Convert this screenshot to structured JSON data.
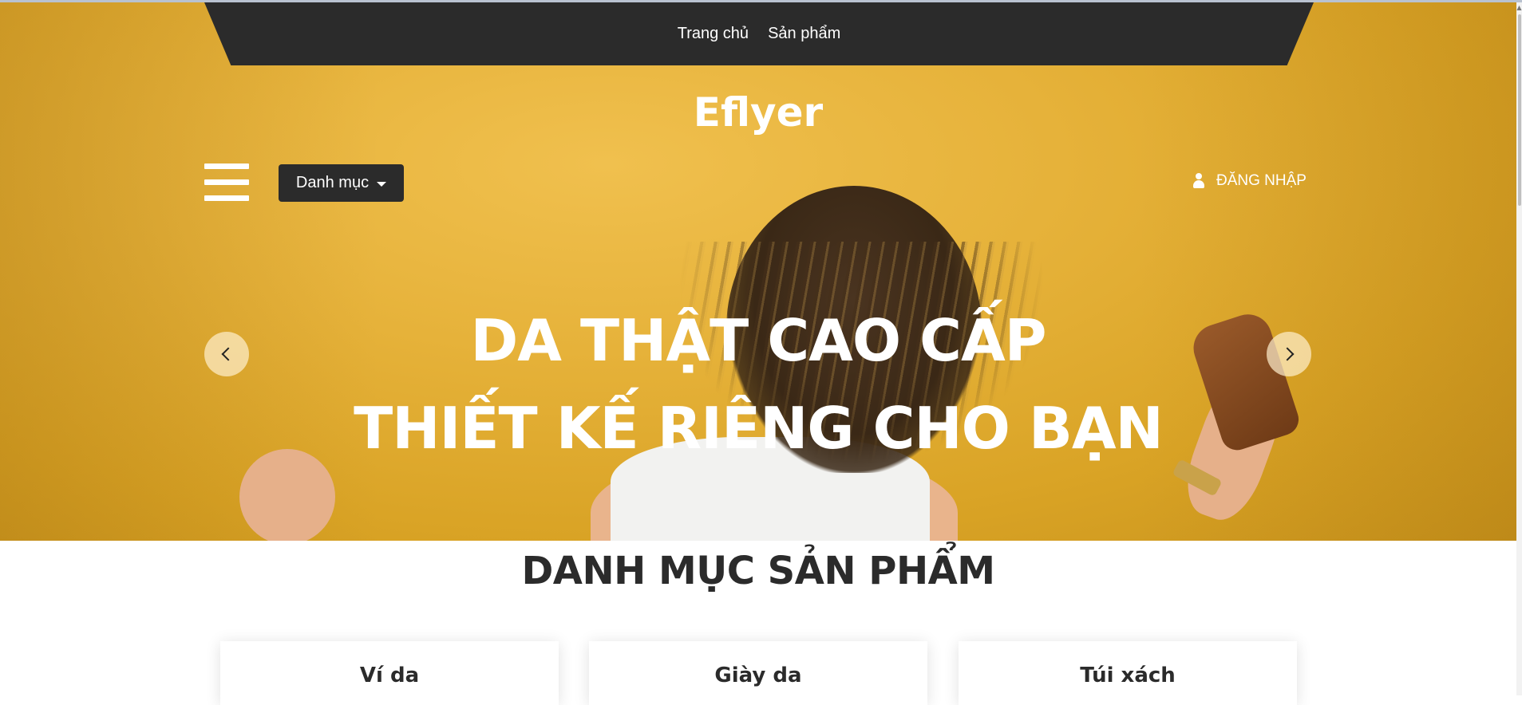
{
  "nav": {
    "home": "Trang chủ",
    "products": "Sản phẩm"
  },
  "logo": "Eflyer",
  "toolbar": {
    "category_label": "Danh mục",
    "login_label": "ĐĂNG NHẬP"
  },
  "hero": {
    "line1": "DA THẬT CAO CẤP",
    "line2": "THIẾT KẾ RIÊNG CHO BẠN"
  },
  "section": {
    "title": "DANH MỤC SẢN PHẨM"
  },
  "categories": [
    {
      "label": "Ví da"
    },
    {
      "label": "Giày da"
    },
    {
      "label": "Túi xách"
    }
  ],
  "colors": {
    "hero_yellow": "#e6b23a",
    "dark": "#2b2b2b",
    "white": "#ffffff"
  },
  "icons": {
    "menu": "hamburger-icon",
    "user": "user-icon",
    "prev": "chevron-left-icon",
    "next": "chevron-right-icon",
    "dropdown": "caret-down-icon"
  }
}
